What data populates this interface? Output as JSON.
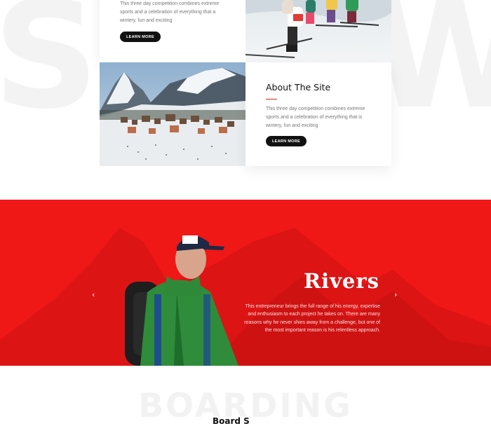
{
  "background_word_top": "SNOW",
  "card_top": {
    "description": "This three day competition combines extreme sports and a celebration of everything that a wintery, fun and exciting",
    "button_label": "LEARN MORE"
  },
  "card_about": {
    "title": "About The Site",
    "description": "This three day competition combines extreme sports and a celebration of everything that is wintery, fun and exciting",
    "button_label": "LEARN MORE"
  },
  "hero": {
    "title": "Rivers",
    "description": "This entrepreneur brings the full range of his energy, expertise and enthusiasm to each project he takes on. There are many reasons why he never shies away from a challenge, but one of the most important reason is his relentless approach.",
    "prev_icon": "chevron-left-icon",
    "next_icon": "chevron-right-icon",
    "prev_glyph": "‹",
    "next_glyph": "›"
  },
  "section_boarding": {
    "background_word": "BOARDING",
    "heading": "Board S"
  },
  "colors": {
    "accent_red": "#f01717",
    "button_black": "#111111"
  }
}
